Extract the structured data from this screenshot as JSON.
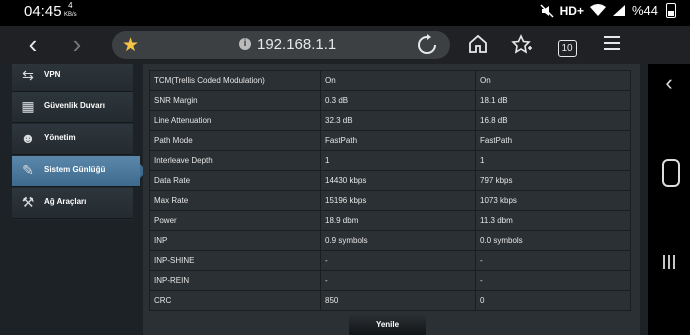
{
  "status_bar": {
    "time": "04:45",
    "speed_value": "4",
    "speed_unit": "KB/s",
    "network": "HD+",
    "battery": "%44"
  },
  "browser": {
    "url": "192.168.1.1",
    "tab_count": "10"
  },
  "sidebar": {
    "items": [
      {
        "label": "VPN",
        "icon": "vpn-icon"
      },
      {
        "label": "Güvenlik Duvarı",
        "icon": "firewall-icon"
      },
      {
        "label": "Yönetim",
        "icon": "admin-icon"
      },
      {
        "label": "Sistem Günlüğü",
        "icon": "system-log-icon",
        "active": true
      },
      {
        "label": "Ağ Araçları",
        "icon": "network-tools-icon"
      }
    ]
  },
  "stats_table": {
    "rows": [
      {
        "name": "TCM(Trellis Coded Modulation)",
        "down": "On",
        "up": "On"
      },
      {
        "name": "SNR Margin",
        "down": "0.3 dB",
        "up": "18.1 dB"
      },
      {
        "name": "Line Attenuation",
        "down": "32.3 dB",
        "up": "16.8 dB"
      },
      {
        "name": "Path Mode",
        "down": "FastPath",
        "up": "FastPath"
      },
      {
        "name": "Interleave Depth",
        "down": "1",
        "up": "1"
      },
      {
        "name": "Data Rate",
        "down": "14430 kbps",
        "up": "797 kbps"
      },
      {
        "name": "Max Rate",
        "down": "15196 kbps",
        "up": "1073 kbps"
      },
      {
        "name": "Power",
        "down": "18.9 dbm",
        "up": "11.3 dbm"
      },
      {
        "name": "INP",
        "down": "0.9 symbols",
        "up": "0.0 symbols"
      },
      {
        "name": "INP-SHINE",
        "down": "-",
        "up": "-"
      },
      {
        "name": "INP-REIN",
        "down": "-",
        "up": "-"
      },
      {
        "name": "CRC",
        "down": "850",
        "up": "0"
      }
    ]
  },
  "actions": {
    "refresh_label": "Yenile"
  }
}
